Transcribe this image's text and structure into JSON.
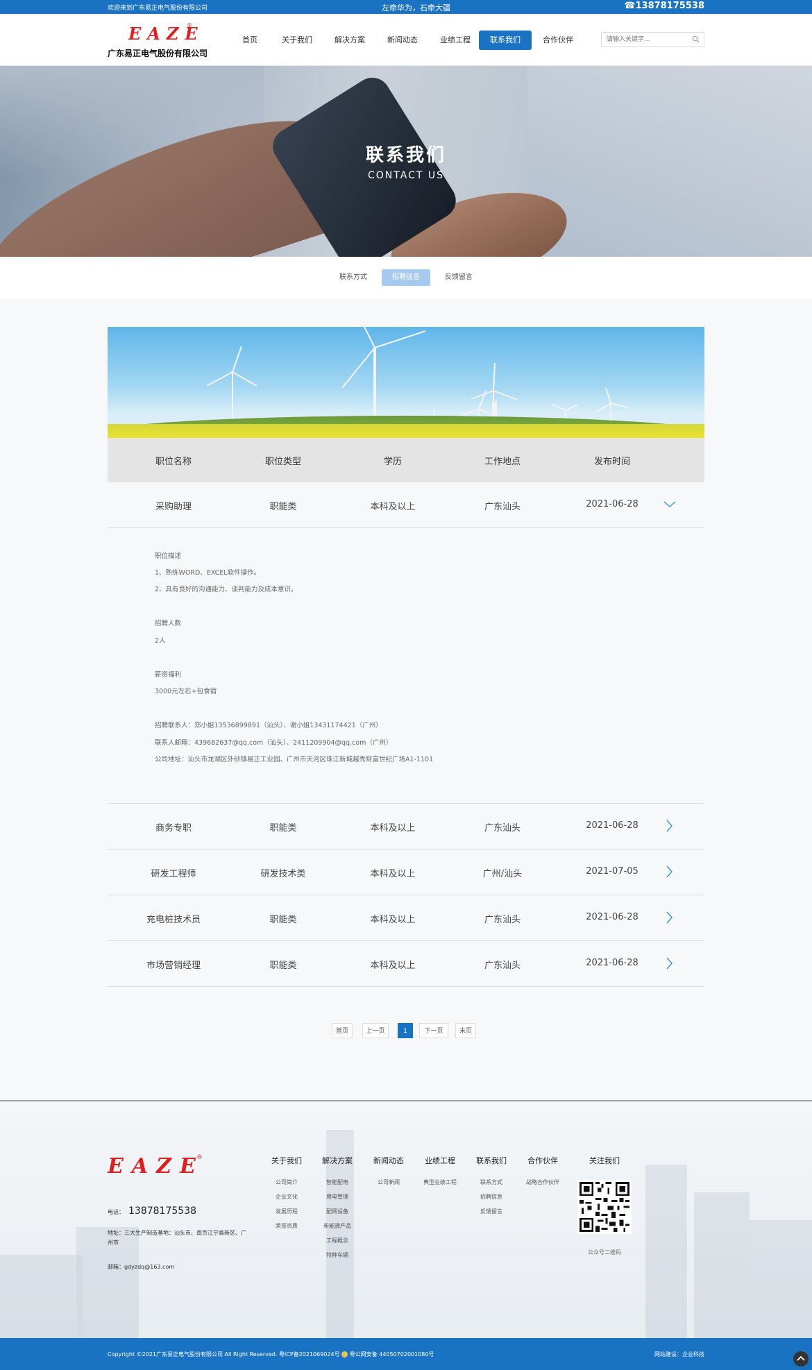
{
  "topbar": {
    "welcome": "欢迎来到广东易正电气股份有限公司",
    "slogan": "左牵华为，石牵大疆",
    "phone": "☎13878175538"
  },
  "brand": {
    "logo_text": "EAZE",
    "reg": "®",
    "company": "广东易正电气股份有限公司"
  },
  "nav": {
    "items": [
      "首页",
      "关于我们",
      "解决方案",
      "新闻动态",
      "业绩工程",
      "联系我们",
      "合作伙伴"
    ],
    "active": "联系我们"
  },
  "search": {
    "placeholder": "请输入关键字..."
  },
  "banner": {
    "title": "联系我们",
    "subtitle": "CONTACT US"
  },
  "subnav": {
    "items": [
      "联系方式",
      "招聘信息",
      "反馈留言"
    ],
    "active": "招聘信息"
  },
  "table": {
    "headers": [
      "职位名称",
      "职位类型",
      "学历",
      "工作地点",
      "发布时间"
    ],
    "rows": [
      {
        "name": "采购助理",
        "type": "职能类",
        "edu": "本科及以上",
        "place": "广东汕头",
        "date": "2021-06-28",
        "expanded": true
      },
      {
        "name": "商务专职",
        "type": "职能类",
        "edu": "本科及以上",
        "place": "广东汕头",
        "date": "2021-06-28"
      },
      {
        "name": "研发工程师",
        "type": "研发技术类",
        "edu": "本科及以上",
        "place": "广州/汕头",
        "date": "2021-07-05"
      },
      {
        "name": "充电桩技术员",
        "type": "职能类",
        "edu": "本科及以上",
        "place": "广东汕头",
        "date": "2021-06-28"
      },
      {
        "name": "市场营销经理",
        "type": "职能类",
        "edu": "本科及以上",
        "place": "广东汕头",
        "date": "2021-06-28"
      }
    ]
  },
  "detail": {
    "desc_title": "职位描述",
    "desc1": "1、熟练WORD、EXCEL软件操作。",
    "desc2": "2、具有良好的沟通能力、谈判能力及成本意识。",
    "count_title": "招聘人数",
    "count": "2人",
    "pay_title": "薪资福利",
    "pay": "3000元左右+包食宿",
    "contact": "招聘联系人：郑小姐13536899891（汕头）、谢小姐13431174421（广州）",
    "email": "联系人邮箱：439682637@qq.com（汕头）、2411209904@qq.com（广州）",
    "address": "公司地址：汕头市龙湖区外砂镇易正工业园、广州市天河区珠江新城越秀财富世纪广场A1-1101"
  },
  "pager": {
    "first": "首页",
    "prev": "上一页",
    "current": "1",
    "next": "下一页",
    "last": "末页"
  },
  "footer": {
    "phone_label": "电话：",
    "phone": "13878175538",
    "address_label": "地址：",
    "address": "三大生产制造基地：汕头市、南京江宁高新区、广州市",
    "email_label": "邮箱：",
    "email": "gdyzdq@163.com",
    "cols": [
      {
        "title": "关于我们",
        "items": [
          "公司简介",
          "企业文化",
          "发展历程",
          "荣誉资质"
        ]
      },
      {
        "title": "解决方案",
        "items": [
          "智能配电",
          "用电管理",
          "配网设备",
          "新能源产品",
          "工程概念",
          "特种车辆"
        ]
      },
      {
        "title": "新闻动态",
        "items": [
          "公司新闻"
        ]
      },
      {
        "title": "业绩工程",
        "items": [
          "典型业绩工程"
        ]
      },
      {
        "title": "联系我们",
        "items": [
          "联系方式",
          "招聘信息",
          "反馈留言"
        ]
      },
      {
        "title": "合作伙伴",
        "items": [
          "战略合作伙伴"
        ]
      }
    ],
    "follow": "关注我们",
    "qr_caption": "公众号二维码",
    "copyright": "Copyright ©2021广东易正电气股份有限公司 All Right Reserved. 粤ICP备2021069024号",
    "police": "粤公网安备 44050702001080号",
    "builder": "网站建设：企业科技"
  },
  "colors": {
    "brand": "#1a73c2",
    "logo_red": "#e02020"
  }
}
